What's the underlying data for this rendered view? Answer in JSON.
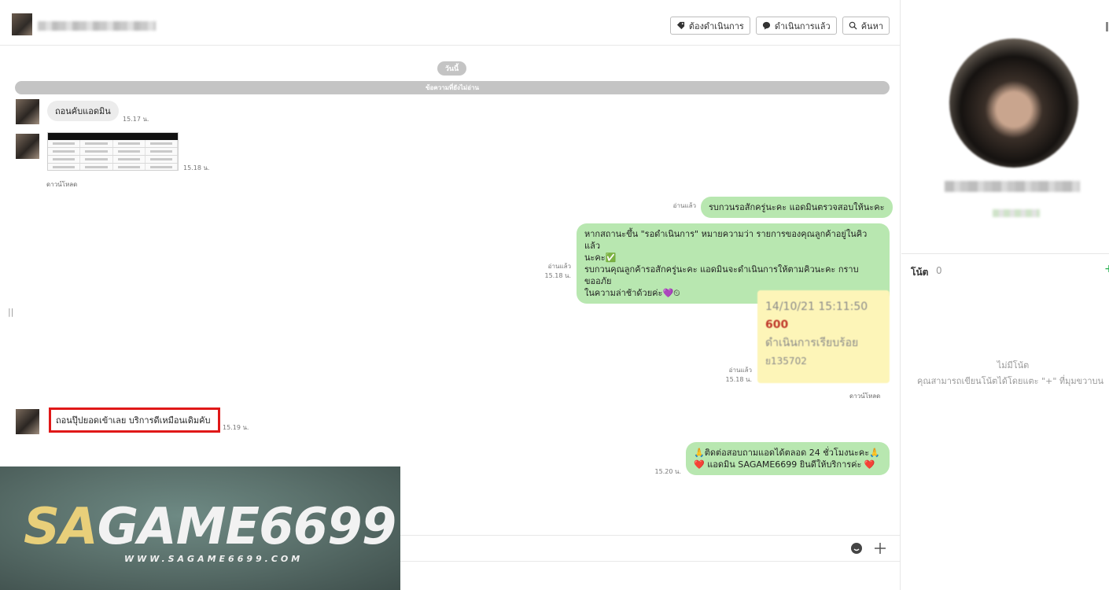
{
  "header": {
    "buttons": [
      {
        "label": "ต้องดำเนินการ",
        "icon": "tag-icon"
      },
      {
        "label": "ดำเนินการแล้ว",
        "icon": "chat-check-icon"
      },
      {
        "label": "ค้นหา",
        "icon": "search-icon"
      }
    ]
  },
  "chat": {
    "date_label": "วันนี้",
    "unread_label": "ข้อความที่ยังไม่อ่าน",
    "messages": [
      {
        "direction": "in",
        "text": "ถอนคับแอดมิน",
        "time": "15.17 น."
      },
      {
        "direction": "in",
        "type": "image",
        "time": "15.18 น.",
        "download": "ดาวน์โหลด"
      },
      {
        "direction": "out",
        "read": "อ่านแล้ว",
        "text": "รบกวนรอสักครู่นะคะ แอดมินตรวจสอบให้นะคะ"
      },
      {
        "direction": "out",
        "read": "อ่านแล้ว",
        "time": "15.18 น.",
        "lines": [
          "หากสถานะขึ้น \"รอดำเนินการ\" หมายความว่า รายการของคุณลูกค้าอยู่ในคิวแล้ว",
          "นะคะ✅",
          "รบกวนคุณลูกค้ารอสักครู่นะคะ แอดมินจะดำเนินการให้ตามคิวนะคะ กราบขออภัย",
          "ในความล่าช้าด้วยค่ะ💜⏲"
        ]
      },
      {
        "direction": "out",
        "type": "image",
        "read": "อ่านแล้ว",
        "time": "15.18 น.",
        "download": "ดาวน์โหลด",
        "receipt": {
          "datetime": "14/10/21 15:11:50",
          "amount": "600",
          "status": "ดำเนินการเรียบร้อย",
          "ref": "ย135702"
        }
      },
      {
        "direction": "in",
        "text": "ถอนปุ๊ปยอดเข้าเลย บริการดีเหมือนเดิมคับ",
        "time": "15.19 น.",
        "highlighted": true
      },
      {
        "direction": "out",
        "time": "15.20 น.",
        "lines": [
          "🙏ติดต่อสอบถามแอดได้ตลอด 24 ชั่วโมงนะคะ🙏",
          "❤️ แอดมิน SAGAME6699 ยินดีให้บริการค่ะ ❤️"
        ]
      }
    ]
  },
  "banner": {
    "logo_sa": "SA",
    "logo_rest": "GAME6699",
    "url": "WWW.SAGAME6699.COM"
  },
  "profile": {
    "notes_title": "โน้ต",
    "notes_count": "0",
    "notes_add": "+",
    "notes_empty": "ไม่มีโน้ต",
    "notes_hint": "คุณสามารถเขียนโน้ตได้โดยแตะ \"+\" ที่มุมขวาบน"
  },
  "colors": {
    "outgoing_bubble": "#b8e7b0",
    "incoming_bubble": "#ececec",
    "highlight_border": "#e01818",
    "accent_green": "#21b04b"
  }
}
